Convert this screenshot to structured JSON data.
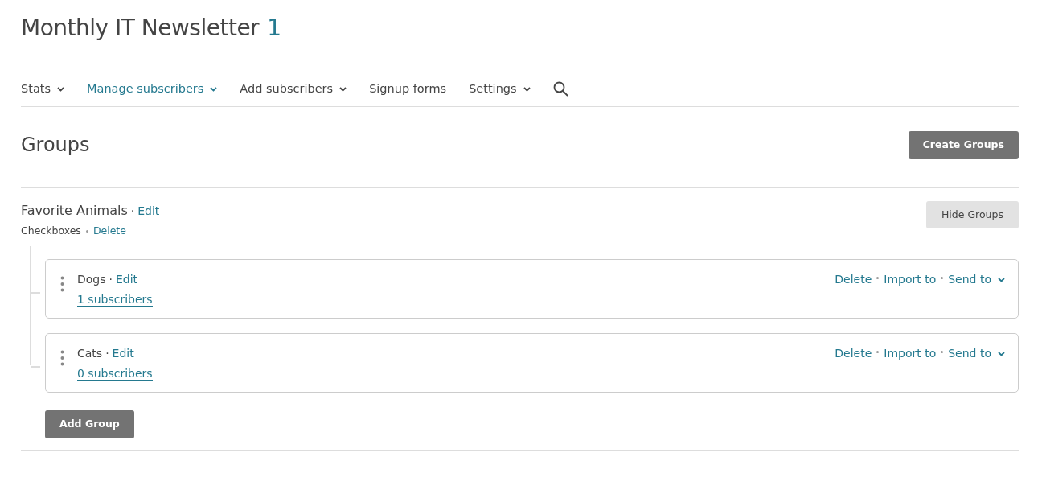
{
  "header": {
    "title": "Monthly IT Newsletter",
    "count": "1"
  },
  "nav": [
    {
      "label": "Stats",
      "dropdown": true,
      "selected": false
    },
    {
      "label": "Manage subscribers",
      "dropdown": true,
      "selected": true
    },
    {
      "label": "Add subscribers",
      "dropdown": true,
      "selected": false
    },
    {
      "label": "Signup forms",
      "dropdown": false,
      "selected": false
    },
    {
      "label": "Settings",
      "dropdown": true,
      "selected": false
    }
  ],
  "section": {
    "title": "Groups",
    "create_button": "Create Groups"
  },
  "category": {
    "name": "Favorite Animals",
    "separator": "·",
    "edit": "Edit",
    "type": "Checkboxes",
    "delete": "Delete",
    "hide_button": "Hide Groups",
    "groups": [
      {
        "name": "Dogs",
        "separator": "·",
        "edit": "Edit",
        "subscribers": "1 subscribers",
        "actions": [
          "Delete",
          "Import to",
          "Send to"
        ]
      },
      {
        "name": "Cats",
        "separator": "·",
        "edit": "Edit",
        "subscribers": "0 subscribers",
        "actions": [
          "Delete",
          "Import to",
          "Send to"
        ]
      }
    ],
    "add_button": "Add Group"
  }
}
